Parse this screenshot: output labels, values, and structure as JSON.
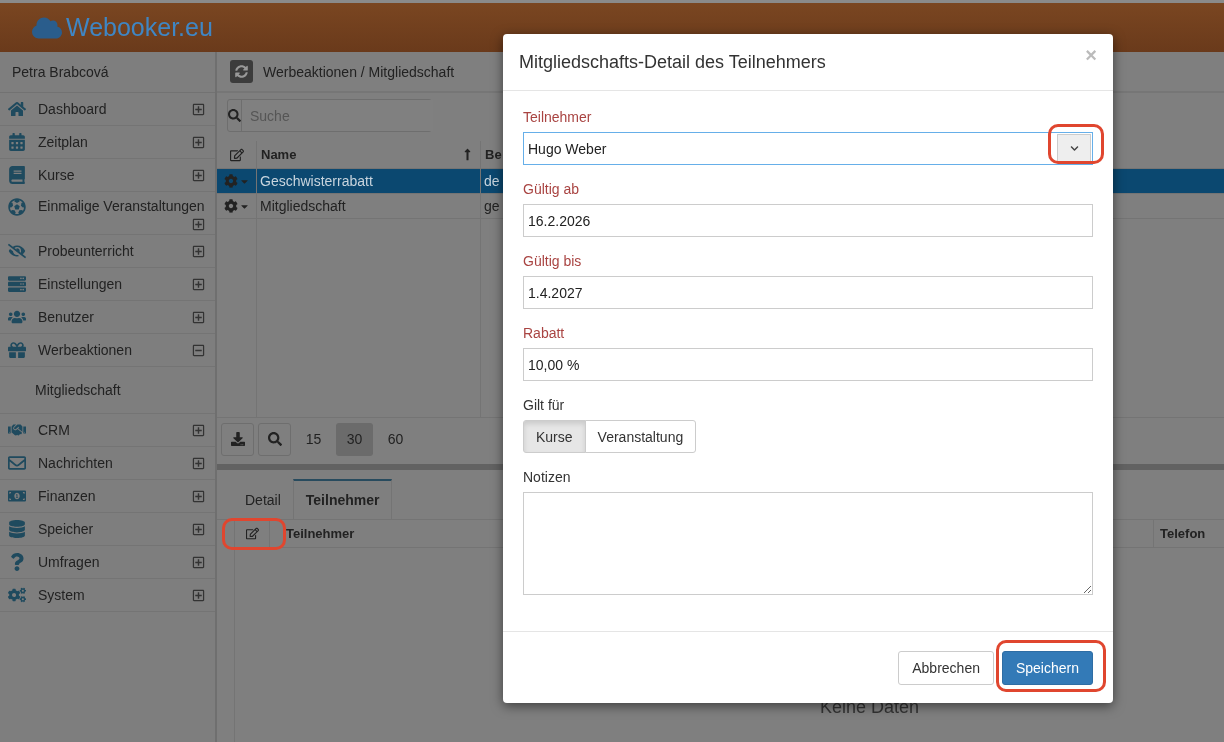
{
  "header": {
    "logo": "Webooker.eu"
  },
  "sidebar": {
    "user": "Petra Brabcová",
    "items": [
      {
        "label": "Dashboard",
        "expanded": false
      },
      {
        "label": "Zeitplan",
        "expanded": false
      },
      {
        "label": "Kurse",
        "expanded": false
      },
      {
        "label": "Einmalige Veranstaltungen",
        "expanded": false
      },
      {
        "label": "Probeunterricht",
        "expanded": false
      },
      {
        "label": "Einstellungen",
        "expanded": false
      },
      {
        "label": "Benutzer",
        "expanded": false
      },
      {
        "label": "Werbeaktionen",
        "expanded": true,
        "children": [
          {
            "label": "Mitgliedschaft"
          }
        ]
      },
      {
        "label": "CRM",
        "expanded": false
      },
      {
        "label": "Nachrichten",
        "expanded": false
      },
      {
        "label": "Finanzen",
        "expanded": false
      },
      {
        "label": "Speicher",
        "expanded": false
      },
      {
        "label": "Umfragen",
        "expanded": false
      },
      {
        "label": "System",
        "expanded": false
      }
    ]
  },
  "breadcrumb": "Werbeaktionen / Mitgliedschaft",
  "search": {
    "placeholder": "Suche"
  },
  "table": {
    "columns": [
      "Name",
      "Be"
    ],
    "rows": [
      {
        "cells": [
          "Geschwisterrabatt",
          "de"
        ],
        "selected": true
      },
      {
        "cells": [
          "Mitgliedschaft",
          "ge"
        ],
        "selected": false
      }
    ]
  },
  "pager": {
    "sizes": [
      {
        "label": "15",
        "selected": false
      },
      {
        "label": "30",
        "selected": true
      },
      {
        "label": "60",
        "selected": false
      }
    ]
  },
  "detail_tabs": [
    {
      "label": "Detail",
      "selected": false
    },
    {
      "label": "Teilnehmer",
      "selected": true
    }
  ],
  "sub_table": {
    "edit_highlighted": true,
    "columns": [
      "Teilnehmer",
      "Telefon"
    ],
    "empty_text": "Keine Daten"
  },
  "modal": {
    "title": "Mitgliedschafts-Detail des Teilnehmers",
    "close": "×",
    "fields": [
      {
        "kind": "select",
        "label": "Teilnehmer",
        "value": "Hugo Weber",
        "required": true,
        "focused": true,
        "highlighted": true
      },
      {
        "kind": "text",
        "label": "Gültig ab",
        "value": "16.2.2026",
        "required": true
      },
      {
        "kind": "text",
        "label": "Gültig bis",
        "value": "1.4.2027",
        "required": true
      },
      {
        "kind": "text",
        "label": "Rabatt",
        "value": "10,00 %",
        "required": true
      },
      {
        "kind": "segmented",
        "label": "Gilt für",
        "required": false,
        "options": [
          {
            "label": "Kurse",
            "selected": true
          },
          {
            "label": "Veranstaltung",
            "selected": false
          }
        ]
      },
      {
        "kind": "textarea",
        "label": "Notizen",
        "required": false
      }
    ],
    "buttons": [
      {
        "label": "Abbrechen",
        "kind": "default",
        "highlighted": false
      },
      {
        "label": "Speichern",
        "kind": "primary",
        "highlighted": true
      }
    ]
  }
}
